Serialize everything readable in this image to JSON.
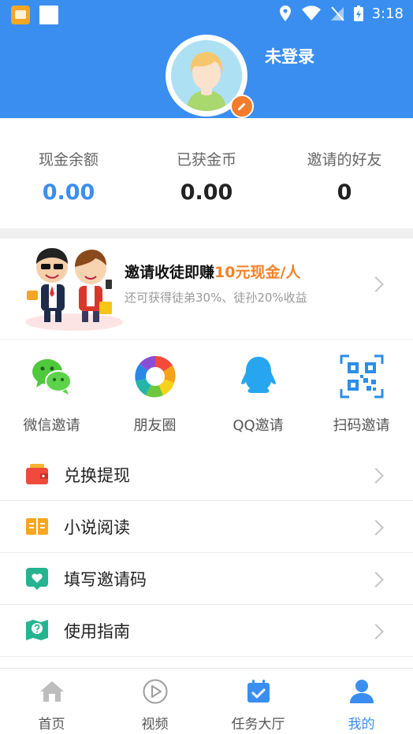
{
  "status_bar": {
    "time": "3:18"
  },
  "profile": {
    "login_status": "未登录"
  },
  "stats": [
    {
      "label": "现金余额",
      "value": "0.00"
    },
    {
      "label": "已获金币",
      "value": "0.00"
    },
    {
      "label": "邀请的好友",
      "value": "0"
    }
  ],
  "banner": {
    "title_prefix": "邀请收徒即赚",
    "title_highlight": "10元现金/人",
    "subtitle": "还可获得徒弟30%、徒孙20%收益"
  },
  "share_options": [
    {
      "label": "微信邀请",
      "icon": "wechat-icon"
    },
    {
      "label": "朋友圈",
      "icon": "moments-icon"
    },
    {
      "label": "QQ邀请",
      "icon": "qq-icon"
    },
    {
      "label": "扫码邀请",
      "icon": "qrcode-icon"
    }
  ],
  "menu": [
    {
      "label": "兑换提现",
      "icon": "wallet-icon"
    },
    {
      "label": "小说阅读",
      "icon": "book-icon"
    },
    {
      "label": "填写邀请码",
      "icon": "invite-code-icon"
    },
    {
      "label": "使用指南",
      "icon": "guide-map-icon"
    }
  ],
  "tabs": [
    {
      "label": "首页",
      "icon": "home-icon"
    },
    {
      "label": "视频",
      "icon": "video-play-icon"
    },
    {
      "label": "任务大厅",
      "icon": "calendar-task-icon"
    },
    {
      "label": "我的",
      "icon": "user-icon"
    }
  ],
  "colors": {
    "primary": "#3a8ef0",
    "accent": "#f5822a"
  }
}
